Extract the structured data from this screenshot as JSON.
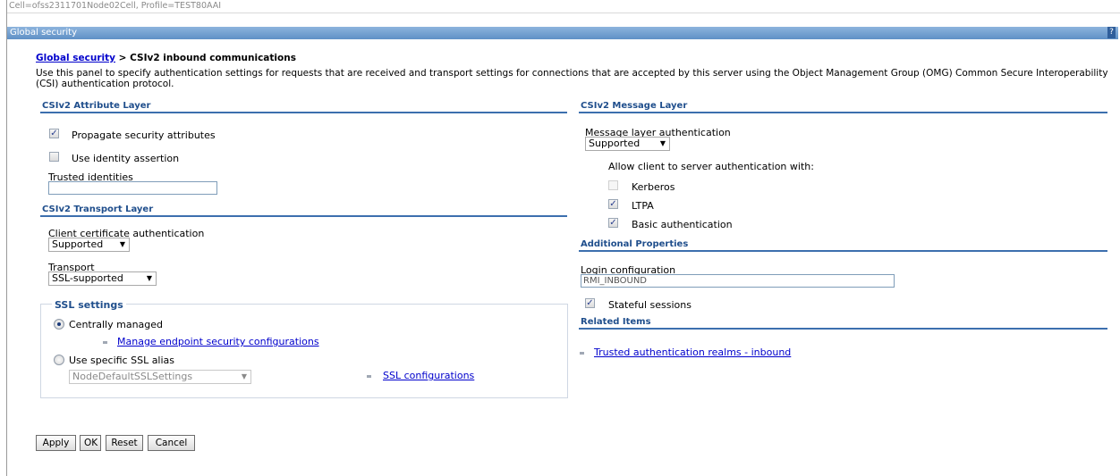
{
  "cell_bar": "Cell=ofss2311701Node02Cell, Profile=TEST80AAI",
  "title_bar": {
    "title": "Global security",
    "help": "?"
  },
  "breadcrumb": {
    "link": "Global security",
    "separator": " > ",
    "current": "CSIv2 inbound communications"
  },
  "description": "Use this panel to specify authentication settings for requests that are received and transport settings for connections that are accepted by this server using the Object Management Group (OMG) Common Secure Interoperability (CSI) authentication protocol.",
  "attribute_layer": {
    "heading": "CSIv2 Attribute Layer",
    "propagate": {
      "label": "Propagate security attributes",
      "checked": true
    },
    "identity_assertion": {
      "label": "Use identity assertion",
      "checked": false
    },
    "trusted_identities": {
      "label": "Trusted identities",
      "value": ""
    }
  },
  "transport_layer": {
    "heading": "CSIv2 Transport Layer",
    "client_cert": {
      "label": "Client certificate authentication",
      "value": "Supported"
    },
    "transport": {
      "label": "Transport",
      "value": "SSL-supported"
    }
  },
  "ssl_settings": {
    "legend": "SSL settings",
    "centrally_managed": {
      "label": "Centrally managed",
      "selected": true
    },
    "manage_link": "Manage endpoint security configurations",
    "specific_alias": {
      "label": "Use specific SSL alias",
      "selected": false
    },
    "alias_value": "NodeDefaultSSLSettings",
    "ssl_config_link": "SSL configurations"
  },
  "message_layer": {
    "heading": "CSIv2 Message Layer",
    "auth_label": "Message layer authentication",
    "auth_value": "Supported",
    "allow_label": "Allow client to server authentication with:",
    "kerberos": {
      "label": "Kerberos",
      "checked": false,
      "disabled": true
    },
    "ltpa": {
      "label": "LTPA",
      "checked": true
    },
    "basic": {
      "label": "Basic authentication",
      "checked": true
    }
  },
  "additional_properties": {
    "heading": "Additional Properties",
    "login_label": "Login configuration",
    "login_value": "RMI_INBOUND",
    "stateful": {
      "label": "Stateful sessions",
      "checked": true
    }
  },
  "related_items": {
    "heading": "Related Items",
    "link": "Trusted authentication realms - inbound"
  },
  "buttons": {
    "apply": "Apply",
    "ok": "OK",
    "reset": "Reset",
    "cancel": "Cancel"
  },
  "check_glyph": "✓",
  "radio_icon": "radio-button",
  "accent_color": "#1f4e8c"
}
